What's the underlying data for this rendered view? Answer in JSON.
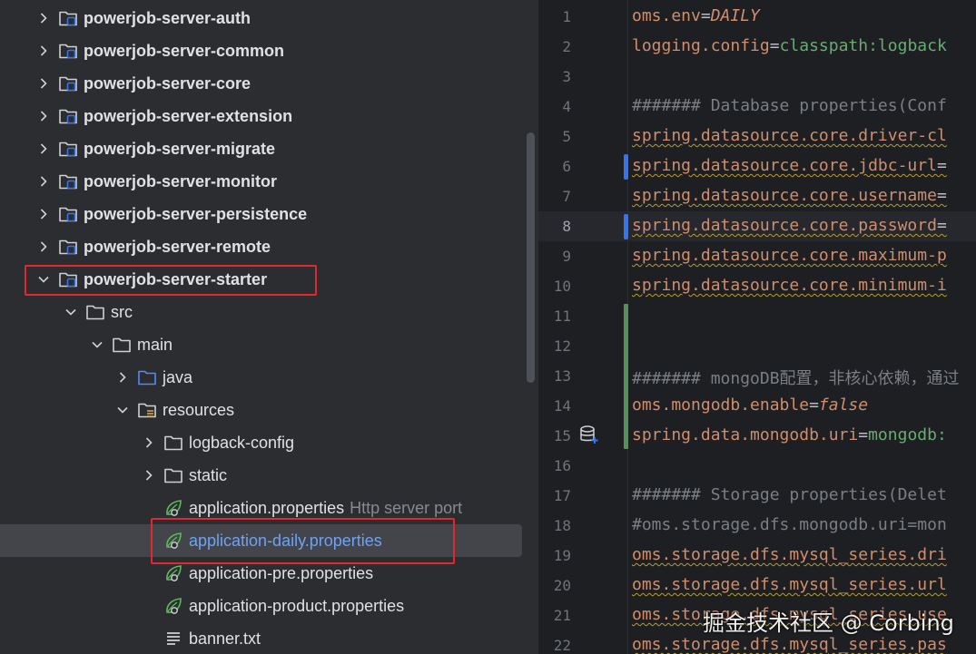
{
  "tree": {
    "items": [
      {
        "label": "powerjob-server-auth",
        "chevron": "right",
        "icon": "module-folder-icon",
        "bold": true
      },
      {
        "label": "powerjob-server-common",
        "chevron": "right",
        "icon": "module-folder-icon",
        "bold": true
      },
      {
        "label": "powerjob-server-core",
        "chevron": "right",
        "icon": "module-folder-icon",
        "bold": true
      },
      {
        "label": "powerjob-server-extension",
        "chevron": "right",
        "icon": "module-folder-icon",
        "bold": true
      },
      {
        "label": "powerjob-server-migrate",
        "chevron": "right",
        "icon": "module-folder-icon",
        "bold": true
      },
      {
        "label": "powerjob-server-monitor",
        "chevron": "right",
        "icon": "module-folder-icon",
        "bold": true
      },
      {
        "label": "powerjob-server-persistence",
        "chevron": "right",
        "icon": "module-folder-icon",
        "bold": true
      },
      {
        "label": "powerjob-server-remote",
        "chevron": "right",
        "icon": "module-folder-icon",
        "bold": true
      },
      {
        "label": "powerjob-server-starter",
        "chevron": "down",
        "icon": "module-folder-icon",
        "bold": true
      },
      {
        "label": "src",
        "chevron": "down",
        "icon": "folder-icon"
      },
      {
        "label": "main",
        "chevron": "down",
        "icon": "folder-icon"
      },
      {
        "label": "java",
        "chevron": "right",
        "icon": "source-folder-icon"
      },
      {
        "label": "resources",
        "chevron": "down",
        "icon": "resources-folder-icon"
      },
      {
        "label": "logback-config",
        "chevron": "right",
        "icon": "folder-icon"
      },
      {
        "label": "static",
        "chevron": "right",
        "icon": "folder-icon"
      },
      {
        "label": "application.properties",
        "hint": "Http server port",
        "icon": "spring-properties-icon"
      },
      {
        "label": "application-daily.properties",
        "icon": "spring-properties-icon",
        "selected": true
      },
      {
        "label": "application-pre.properties",
        "icon": "spring-properties-icon"
      },
      {
        "label": "application-product.properties",
        "icon": "spring-properties-icon"
      },
      {
        "label": "banner.txt",
        "icon": "text-file-icon"
      }
    ]
  },
  "editor": {
    "current_line": 8,
    "lines": [
      {
        "n": "1",
        "key": "oms.env",
        "eq": "=",
        "val": "DAILY",
        "val_style": "kw"
      },
      {
        "n": "2",
        "key": "logging.config",
        "eq": "=",
        "val": "classpath:logback"
      },
      {
        "n": "3"
      },
      {
        "n": "4",
        "comment": "####### Database properties(Conf"
      },
      {
        "n": "5",
        "key": "spring.datasource.core.driver-cl",
        "wavy": true
      },
      {
        "n": "6",
        "key": "spring.datasource.core.jdbc-url",
        "eq": "=",
        "wavy": true
      },
      {
        "n": "7",
        "key": "spring.datasource.core.username",
        "eq": "=",
        "wavy": true
      },
      {
        "n": "8",
        "key": "spring.datasource.core.password",
        "eq": "=",
        "wavy": true
      },
      {
        "n": "9",
        "key": "spring.datasource.core.maximum-p",
        "wavy": true
      },
      {
        "n": "10",
        "key": "spring.datasource.core.minimum-i",
        "wavy": true
      },
      {
        "n": "11"
      },
      {
        "n": "12"
      },
      {
        "n": "13",
        "comment": "####### mongoDB配置，非核心依赖，通过"
      },
      {
        "n": "14",
        "key": "oms.mongodb.enable",
        "eq": "=",
        "val": "false",
        "val_style": "kw"
      },
      {
        "n": "15",
        "key": "spring.data.mongodb.uri",
        "eq": "=",
        "val": "mongodb:"
      },
      {
        "n": "16"
      },
      {
        "n": "17",
        "comment": "####### Storage properties(Delet"
      },
      {
        "n": "18",
        "comment": "#oms.storage.dfs.mongodb.uri=mon"
      },
      {
        "n": "19",
        "key": "oms.storage.dfs.mysql_series.dri",
        "wavy": true
      },
      {
        "n": "20",
        "key": "oms.storage.dfs.mysql_series.url",
        "wavy": true
      },
      {
        "n": "21",
        "key": "oms.storage.dfs.mysql_series.use",
        "wavy": true
      },
      {
        "n": "22",
        "key": "oms.storage.dfs.mysql_series.pas",
        "wavy": true
      }
    ]
  },
  "watermark": "掘金技术社区 @ Corbing",
  "colors": {
    "selection_box": "#e0282e",
    "accent_blue": "#3574f0",
    "vcs_added": "#549159"
  }
}
